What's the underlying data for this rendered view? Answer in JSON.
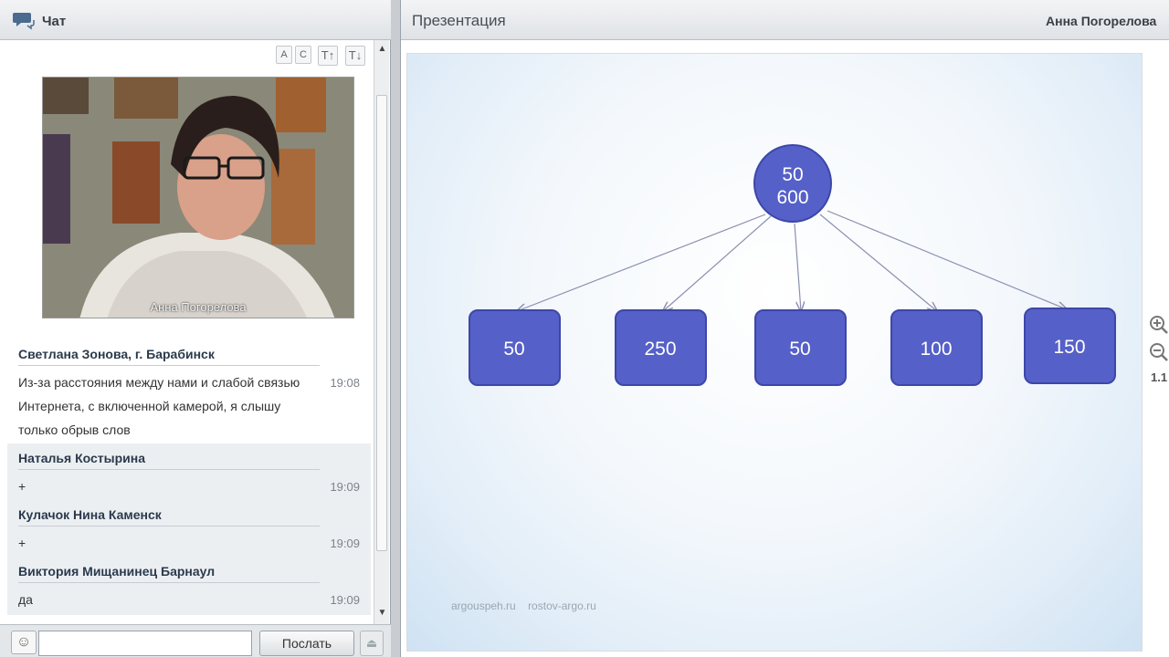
{
  "chat": {
    "title": "Чат",
    "video_caption": "Анна Погорелова",
    "messages": [
      {
        "author": "Светлана Зонова, г. Барабинск",
        "time": "19:08",
        "lines": [
          "Из-за расстояния между нами и слабой связью",
          "Интернета, с включенной камерой, я слышу",
          "только обрыв слов"
        ]
      },
      {
        "author": "Наталья Костырина",
        "time": "19:09",
        "lines": [
          "+"
        ]
      },
      {
        "author": "Кулачок Нина Каменск",
        "time": "19:09",
        "lines": [
          "+"
        ]
      },
      {
        "author": "Виктория Мищанинец Барнаул",
        "time": "19:09",
        "lines": [
          "да"
        ]
      }
    ],
    "send_label": "Послать",
    "input_value": "",
    "toolbar": {
      "btn1": "A",
      "btn2": "C",
      "btn3": "T↑",
      "btn4": "T↓"
    }
  },
  "presentation": {
    "title": "Презентация",
    "presenter": "Анна  Погорелова",
    "zoom_level": "1.1",
    "root_line1": "50",
    "root_line2": "600",
    "children": [
      "50",
      "250",
      "50",
      "100",
      "150"
    ],
    "footer_link1": "argouspeh.ru",
    "footer_link2": "rostov-argo.ru",
    "colors": {
      "node": "#5560c8",
      "node_border": "#3d47a8",
      "arrow": "#8a8fb0"
    }
  },
  "icons": [
    "chat-bubbles-icon",
    "smile-icon",
    "zoom-in-icon",
    "zoom-out-icon"
  ]
}
